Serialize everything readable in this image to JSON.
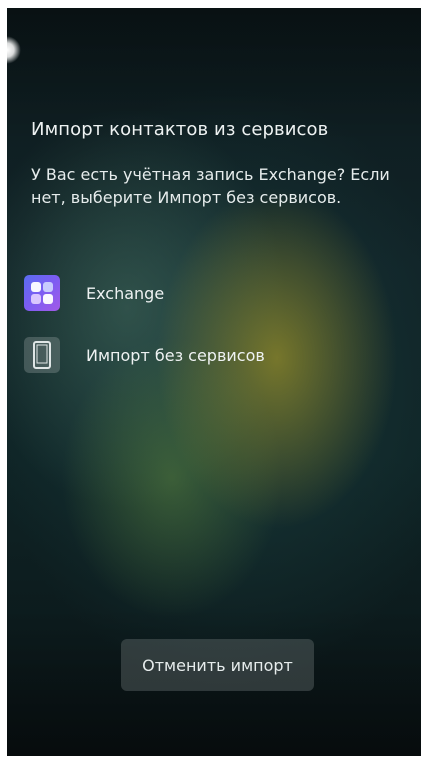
{
  "dialog": {
    "title": "Импорт контактов из сервисов",
    "message": "У Вас есть учётная запись Exchange? Если нет, выберите Импорт без сервисов.",
    "options": [
      {
        "label": "Exchange",
        "icon": "exchange-app-icon"
      },
      {
        "label": "Импорт без сервисов",
        "icon": "phone-icon"
      }
    ],
    "cancel_label": "Отменить импорт"
  },
  "colors": {
    "text": "#eef2f2",
    "exchange_icon_start": "#5a6cf0",
    "exchange_icon_end": "#a25be8",
    "button_bg": "#5a6464"
  }
}
